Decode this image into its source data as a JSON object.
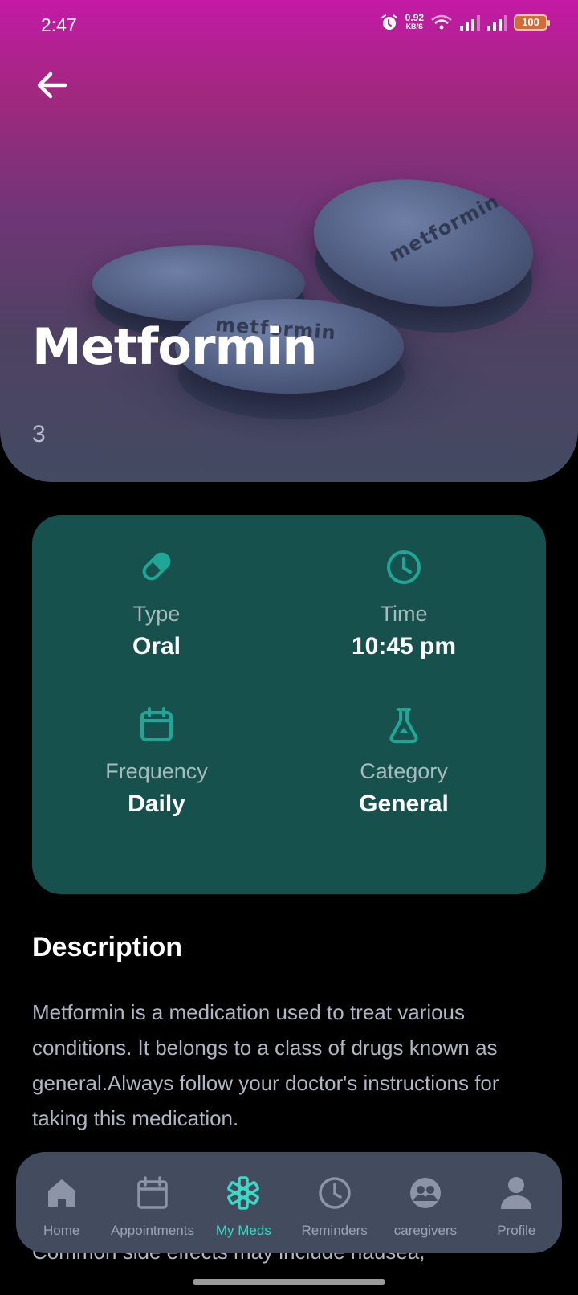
{
  "status_bar": {
    "time": "2:47",
    "net_speed_value": "0.92",
    "net_speed_unit": "KB/S",
    "battery": "100"
  },
  "hero": {
    "title": "Metformin",
    "dose": "3",
    "pill_imprint_front": "metformin",
    "pill_imprint_right": "metformin"
  },
  "info": {
    "type_label": "Type",
    "type_value": "Oral",
    "time_label": "Time",
    "time_value": "10:45 pm",
    "frequency_label": "Frequency",
    "frequency_value": "Daily",
    "category_label": "Category",
    "category_value": "General"
  },
  "description": {
    "heading": "Description",
    "text": "Metformin is a medication used to treat various conditions. It belongs to a class of drugs known as general.Always follow your doctor's instructions for taking this medication.",
    "text_more": "Common side effects may include nausea,"
  },
  "nav": {
    "items": [
      {
        "label": "Home",
        "icon": "home-icon",
        "active": false
      },
      {
        "label": "Appointments",
        "icon": "calendar-icon",
        "active": false
      },
      {
        "label": "My Meds",
        "icon": "medical-asterisk-icon",
        "active": true
      },
      {
        "label": "Reminders",
        "icon": "clock-icon",
        "active": false
      },
      {
        "label": "caregivers",
        "icon": "group-icon",
        "active": false
      },
      {
        "label": "Profile",
        "icon": "person-icon",
        "active": false
      }
    ]
  },
  "colors": {
    "accent": "#3fd8c6",
    "card": "#16514d",
    "icon_teal": "#1fa696",
    "nav_bg": "#434b5f"
  }
}
